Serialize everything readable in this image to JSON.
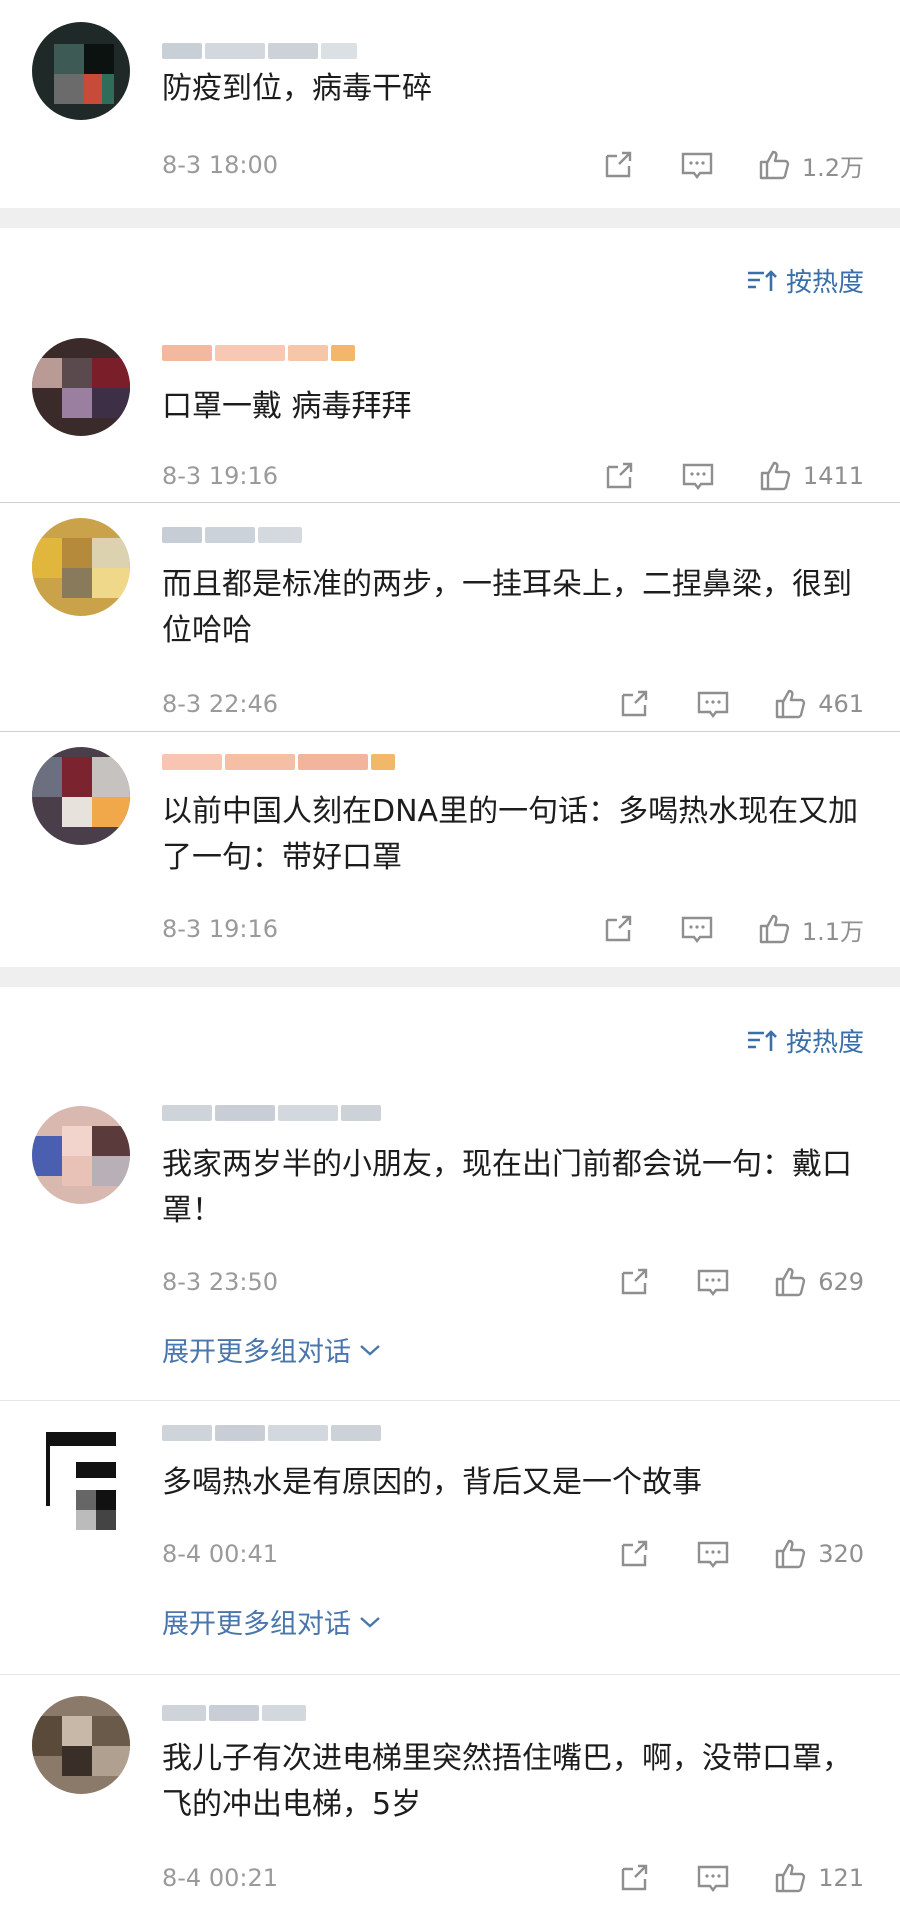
{
  "sort_label": "按热度",
  "expand_label": "展开更多组对话",
  "top_comment": {
    "text": "防疫到位，病毒干碎",
    "time": "8-3 18:00",
    "likes": "1.2万"
  },
  "group1": [
    {
      "text": "口罩一戴 病毒拜拜",
      "time": "8-3 19:16",
      "likes": "1411"
    },
    {
      "text": "而且都是标准的两步，一挂耳朵上，二捏鼻梁，很到位哈哈",
      "time": "8-3 22:46",
      "likes": "461"
    },
    {
      "text": "以前中国人刻在DNA里的一句话：多喝热水现在又加了一句：带好口罩",
      "time": "8-3 19:16",
      "likes": "1.1万"
    }
  ],
  "group2": [
    {
      "text": "我家两岁半的小朋友，现在出门前都会说一句：戴口罩！",
      "time": "8-3 23:50",
      "likes": "629"
    },
    {
      "text": "多喝热水是有原因的，背后又是一个故事",
      "time": "8-4 00:41",
      "likes": "320"
    },
    {
      "text": "我儿子有次进电梯里突然捂住嘴巴，啊，没带口罩，飞的冲出电梯，5岁",
      "time": "8-4 00:21",
      "likes": "121"
    }
  ],
  "icons": {
    "share": "share-icon",
    "comment": "comment-icon",
    "like": "thumbs-up-icon",
    "sort": "sort-icon",
    "expand": "chevron-down-icon"
  },
  "colors": {
    "link": "#4a76ad",
    "meta": "#9a9a9a",
    "separator": "#efefef"
  }
}
